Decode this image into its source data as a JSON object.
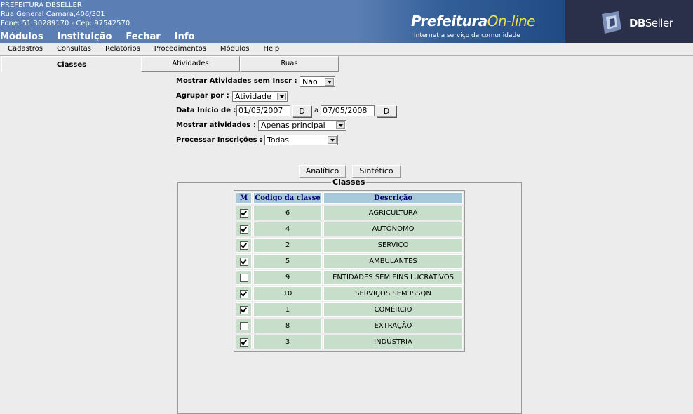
{
  "header": {
    "org_name": "PREFEITURA DBSELLER",
    "address": "Rua General Camara,406/301",
    "contact": "Fone: 51 30289170  -  Cep: 97542570",
    "main_menu": [
      "Módulos",
      "Instituição",
      "Fechar",
      "Info"
    ],
    "logo_prefeitura": "Prefeitura",
    "logo_online": "On-line",
    "logo_tagline": "Internet a serviço da comunidade",
    "logo_db": "DB",
    "logo_seller": "Seller"
  },
  "menubar": [
    "Cadastros",
    "Consultas",
    "Relatórios",
    "Procedimentos",
    "Módulos",
    "Help"
  ],
  "tabs": [
    "Classes",
    "Atividades",
    "Ruas"
  ],
  "form": {
    "mostrar_sem_inscr_label": "Mostrar Atividades sem Inscr :",
    "mostrar_sem_inscr_value": "Não",
    "agrupar_label": "Agrupar por :",
    "agrupar_value": "Atividade",
    "data_inicio_label": "Data Início de :",
    "data_inicio": "01/05/2007",
    "data_sep": "a",
    "data_fim": "07/05/2008",
    "date_button": "D",
    "mostrar_atividades_label": "Mostrar atividades :",
    "mostrar_atividades_value": "Apenas principal",
    "processar_label": "Processar Inscrições :",
    "processar_value": "Todas"
  },
  "buttons": {
    "analitico": "Analítico",
    "sintetico": "Sintético"
  },
  "classes": {
    "legend": "Classes",
    "headers": [
      "M",
      "Codigo da classe",
      "Descrição"
    ],
    "rows": [
      {
        "checked": true,
        "code": "6",
        "desc": "AGRICULTURA"
      },
      {
        "checked": true,
        "code": "4",
        "desc": "AUTÔNOMO"
      },
      {
        "checked": true,
        "code": "2",
        "desc": "SERVIÇO"
      },
      {
        "checked": true,
        "code": "5",
        "desc": "AMBULANTES"
      },
      {
        "checked": false,
        "code": "9",
        "desc": "ENTIDADES SEM FINS LUCRATIVOS"
      },
      {
        "checked": true,
        "code": "10",
        "desc": "SERVIÇOS SEM ISSQN"
      },
      {
        "checked": true,
        "code": "1",
        "desc": "COMÉRCIO"
      },
      {
        "checked": false,
        "code": "8",
        "desc": "EXTRAÇÃO"
      },
      {
        "checked": true,
        "code": "3",
        "desc": "INDÚSTRIA"
      }
    ]
  }
}
